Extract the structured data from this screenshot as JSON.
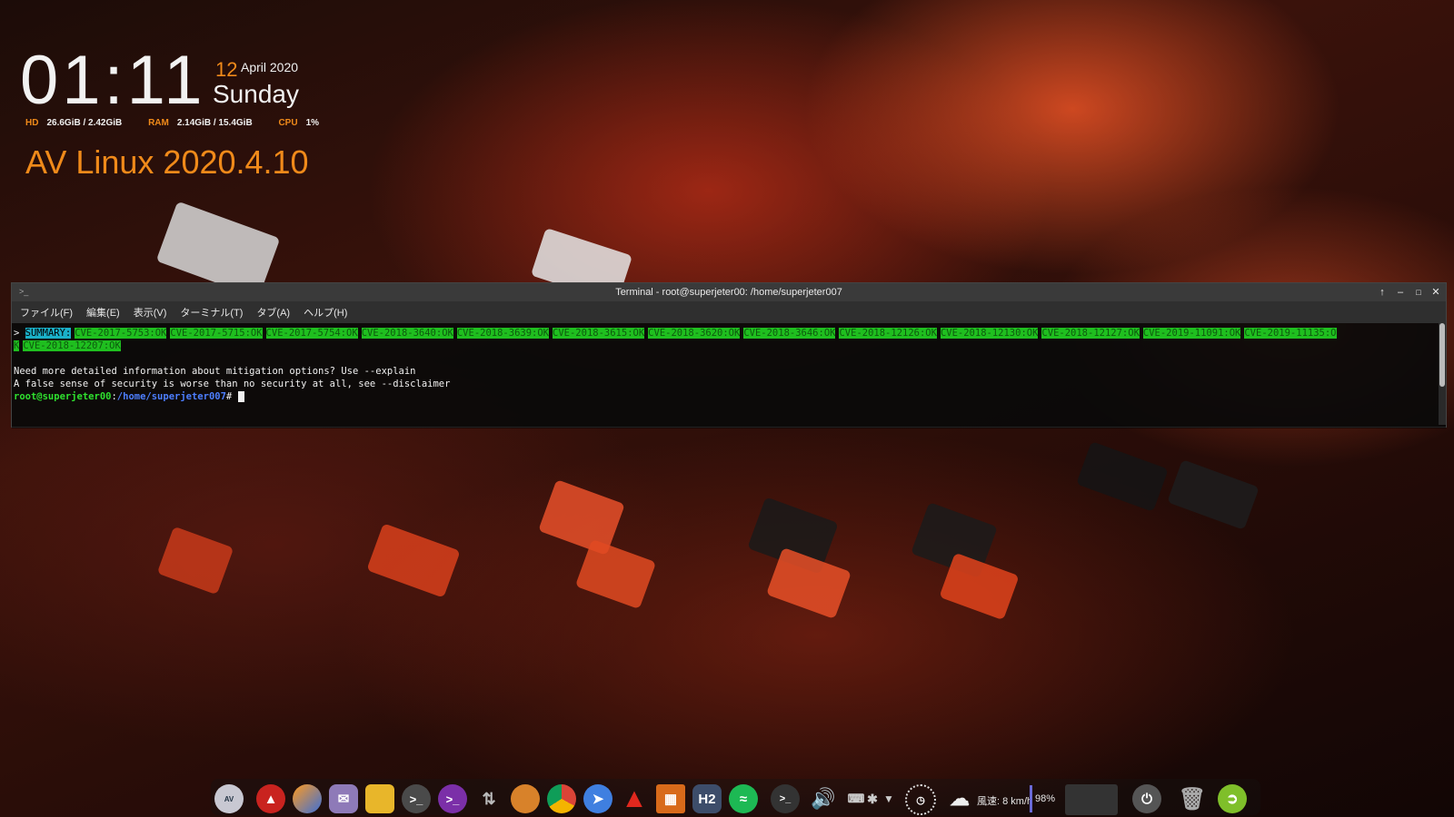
{
  "conky": {
    "time": "01:11",
    "day": "12",
    "month_year": "April 2020",
    "weekday": "Sunday",
    "stats": [
      {
        "label": "HD",
        "value": "26.6GiB / 2.42GiB"
      },
      {
        "label": "RAM",
        "value": "2.14GiB / 15.4GiB"
      },
      {
        "label": "CPU",
        "value": "1%"
      }
    ],
    "distro": "AV Linux 2020.4.10"
  },
  "terminal": {
    "title": "Terminal - root@superjeter00: /home/superjeter007",
    "menu": [
      "ファイル(F)",
      "編集(E)",
      "表示(V)",
      "ターミナル(T)",
      "タブ(A)",
      "ヘルプ(H)"
    ],
    "line1_prefix": "> ",
    "summary_label": "SUMMARY:",
    "cves": [
      "CVE-2017-5753:OK",
      "CVE-2017-5715:OK",
      "CVE-2017-5754:OK",
      "CVE-2018-3640:OK",
      "CVE-2018-3639:OK",
      "CVE-2018-3615:OK",
      "CVE-2018-3620:OK",
      "CVE-2018-3646:OK",
      "CVE-2018-12126:OK",
      "CVE-2018-12130:OK",
      "CVE-2018-12127:OK",
      "CVE-2019-11091:OK",
      "CVE-2019-11135:O"
    ],
    "wrap_start": "K",
    "cve_last": "CVE-2018-12207:OK",
    "info1": "Need more detailed information about mitigation options? Use --explain",
    "info2": "A false sense of security is worse than no security at all, see --disclaimer",
    "prompt_user": "root@superjeter00",
    "prompt_sep": ":",
    "prompt_path": "/home/superjeter007",
    "prompt_end": "# "
  },
  "tray": {
    "wind": "風速: 8 km/h",
    "battery": "98%"
  },
  "dock_icons": [
    "av-linux-icon",
    "acrobat-icon",
    "firefox-icon",
    "mail-icon",
    "files-icon",
    "terminal-icon",
    "powershell-icon",
    "mixer-icon",
    "gimp-icon",
    "chrome-icon",
    "safari-icon",
    "ardour-icon",
    "app-grid-icon",
    "hydrogen-icon",
    "spotify-icon"
  ],
  "colors": {
    "accent_orange": "#f08a1a",
    "ok_green": "#1fbf1f",
    "summary_cyan": "#1ab0c8",
    "prompt_green": "#2fe02f",
    "prompt_blue": "#4d7fff"
  }
}
